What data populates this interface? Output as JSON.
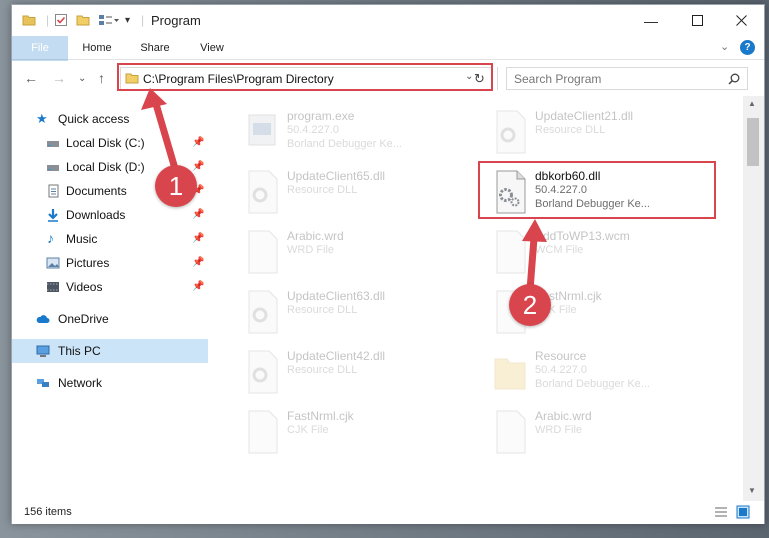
{
  "window": {
    "title": "Program",
    "quick_access_toolbar": [
      "folder-icon",
      "properties-icon",
      "new-folder-icon",
      "customize-icon"
    ]
  },
  "ribbon": {
    "tabs": [
      "File",
      "Home",
      "Share",
      "View"
    ]
  },
  "navigation": {
    "address": "C:\\Program Files\\Program Directory",
    "search_placeholder": "Search Program"
  },
  "sidebar": {
    "items": [
      {
        "label": "Quick access",
        "icon": "star-icon",
        "pinned": false
      },
      {
        "label": "Local Disk (C:)",
        "icon": "drive-icon",
        "pinned": true
      },
      {
        "label": "Local Disk (D:)",
        "icon": "drive-icon",
        "pinned": true
      },
      {
        "label": "Documents",
        "icon": "documents-icon",
        "pinned": true
      },
      {
        "label": "Downloads",
        "icon": "downloads-icon",
        "pinned": true
      },
      {
        "label": "Music",
        "icon": "music-icon",
        "pinned": true
      },
      {
        "label": "Pictures",
        "icon": "pictures-icon",
        "pinned": true
      },
      {
        "label": "Videos",
        "icon": "videos-icon",
        "pinned": true
      },
      {
        "label": "OneDrive",
        "icon": "cloud-icon",
        "pinned": false
      },
      {
        "label": "This PC",
        "icon": "computer-icon",
        "pinned": false,
        "selected": true
      },
      {
        "label": "Network",
        "icon": "network-icon",
        "pinned": false
      }
    ]
  },
  "files": [
    {
      "name": "program.exe",
      "line2": "50.4.227.0",
      "line3": "Borland Debugger Ke...",
      "icon": "exe-icon"
    },
    {
      "name": "UpdateClient21.dll",
      "line2": "Resource DLL",
      "line3": "",
      "icon": "dll-icon"
    },
    {
      "name": "UpdateClient65.dll",
      "line2": "Resource DLL",
      "line3": "",
      "icon": "dll-icon"
    },
    {
      "name": "dbkorb60.dll",
      "line2": "50.4.227.0",
      "line3": "Borland Debugger Ke...",
      "icon": "dll-icon",
      "highlighted": true
    },
    {
      "name": "Arabic.wrd",
      "line2": "WRD File",
      "line3": "",
      "icon": "blank-file-icon"
    },
    {
      "name": "AddToWP13.wcm",
      "line2": "WCM File",
      "line3": "",
      "icon": "blank-file-icon"
    },
    {
      "name": "UpdateClient63.dll",
      "line2": "Resource DLL",
      "line3": "",
      "icon": "dll-icon"
    },
    {
      "name": "FastNrml.cjk",
      "line2": "CJK File",
      "line3": "",
      "icon": "blank-file-icon"
    },
    {
      "name": "UpdateClient42.dll",
      "line2": "Resource DLL",
      "line3": "",
      "icon": "dll-icon"
    },
    {
      "name": "Resource",
      "line2": "50.4.227.0",
      "line3": "Borland Debugger Ke...",
      "icon": "folder-icon"
    },
    {
      "name": "FastNrml.cjk",
      "line2": "CJK File",
      "line3": "",
      "icon": "blank-file-icon"
    },
    {
      "name": "Arabic.wrd",
      "line2": "WRD File",
      "line3": "",
      "icon": "blank-file-icon"
    }
  ],
  "status": {
    "item_count": "156 items"
  },
  "annotations": {
    "marker1": "1",
    "marker2": "2",
    "color": "#d9454c"
  },
  "colors": {
    "accent": "#1979ca",
    "selection": "#cce4f7"
  }
}
